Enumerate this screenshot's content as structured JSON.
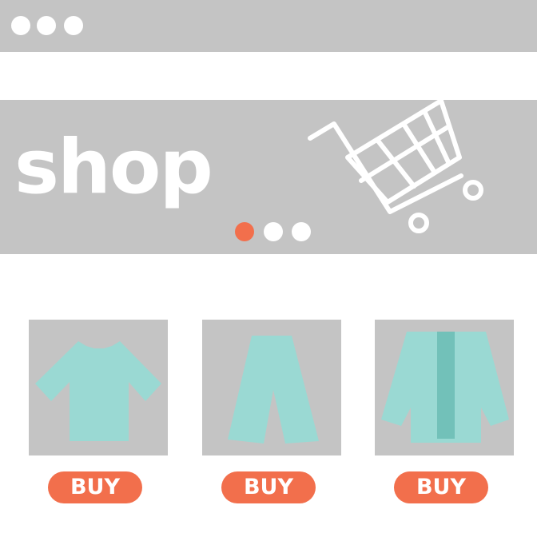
{
  "window": {
    "controls": [
      "window-dot-icon",
      "window-dot-icon",
      "window-dot-icon"
    ]
  },
  "hero": {
    "title": "shop",
    "carousel": {
      "slides": 3,
      "active_index": 0
    },
    "icon": "shopping-cart-icon"
  },
  "products": [
    {
      "icon": "tshirt-icon",
      "buy_label": "BUY"
    },
    {
      "icon": "pants-icon",
      "buy_label": "BUY"
    },
    {
      "icon": "cardigan-icon",
      "buy_label": "BUY"
    }
  ],
  "colors": {
    "frame": "#c4c4c4",
    "background": "#ffffff",
    "accent": "#f26f4c",
    "garment": "#9ad9d3",
    "garment_dark": "#72c1b9"
  }
}
